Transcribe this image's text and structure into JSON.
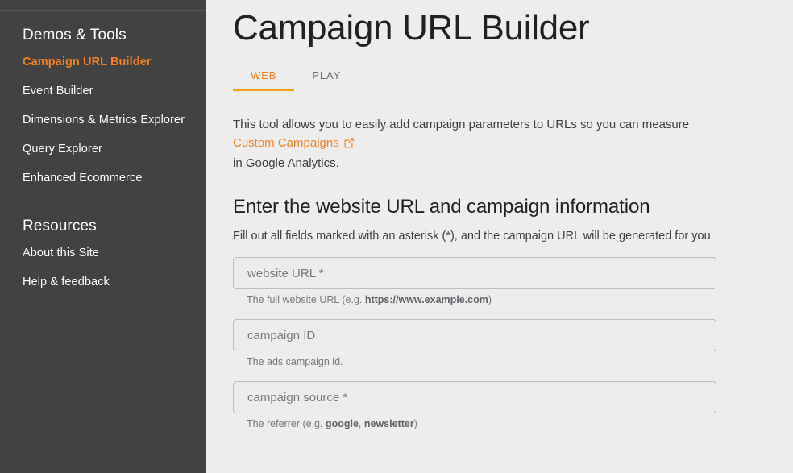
{
  "sidebar": {
    "sections": [
      {
        "heading": "Demos & Tools",
        "items": [
          {
            "label": "Campaign URL Builder",
            "active": true
          },
          {
            "label": "Event Builder",
            "active": false
          },
          {
            "label": "Dimensions & Metrics Explorer",
            "active": false
          },
          {
            "label": "Query Explorer",
            "active": false
          },
          {
            "label": "Enhanced Ecommerce",
            "active": false
          }
        ]
      },
      {
        "heading": "Resources",
        "items": [
          {
            "label": "About this Site",
            "active": false
          },
          {
            "label": "Help & feedback",
            "active": false
          }
        ]
      }
    ]
  },
  "main": {
    "title": "Campaign URL Builder",
    "tabs": [
      {
        "label": "WEB",
        "active": true
      },
      {
        "label": "PLAY",
        "active": false
      }
    ],
    "intro": {
      "line1": "This tool allows you to easily add campaign parameters to URLs so you can measure",
      "link_text": "Custom Campaigns",
      "link_icon": "external-link-icon",
      "line3": "in Google Analytics."
    },
    "section_title": "Enter the website URL and campaign information",
    "section_subtitle": "Fill out all fields marked with an asterisk (*), and the campaign URL will be generated for you.",
    "fields": [
      {
        "name": "website-url",
        "placeholder": "website URL *",
        "value": "",
        "hint_prefix": "The full website URL (e.g. ",
        "hint_bold": "https://www.example.com",
        "hint_suffix": ")"
      },
      {
        "name": "campaign-id",
        "placeholder": "campaign ID",
        "value": "",
        "hint_prefix": "The ads campaign id.",
        "hint_bold": "",
        "hint_suffix": ""
      },
      {
        "name": "campaign-source",
        "placeholder": "campaign source *",
        "value": "",
        "hint_prefix": "The referrer (e.g. ",
        "hint_bold": "google",
        "hint_mid": ", ",
        "hint_bold2": "newsletter",
        "hint_suffix": ")"
      }
    ]
  },
  "colors": {
    "accent": "#f58220",
    "tab_underline": "#f9a01b",
    "sidebar_bg": "#424242",
    "content_bg": "#ededed",
    "title": "#212121"
  }
}
